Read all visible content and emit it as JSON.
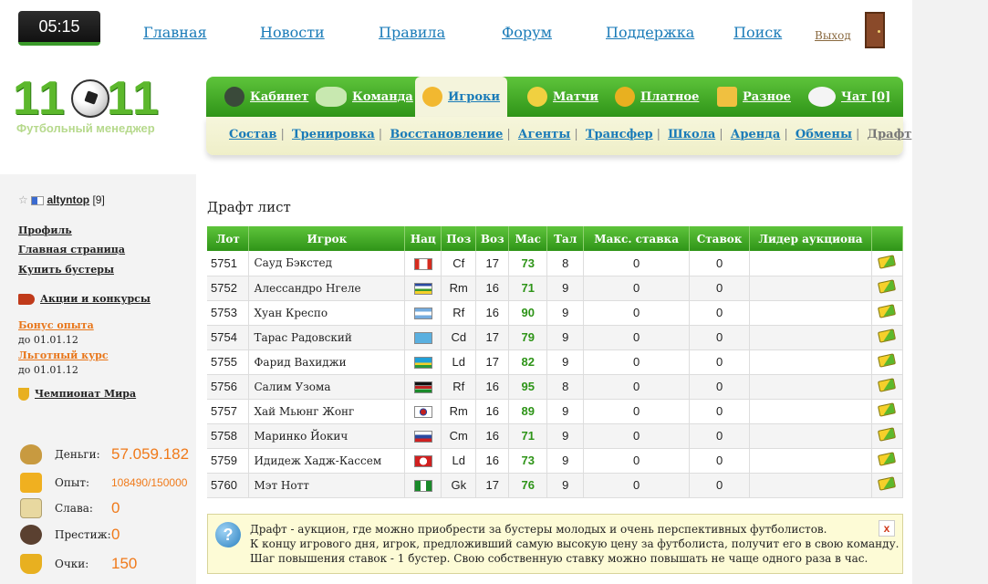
{
  "clock": "05:15",
  "top_nav": [
    "Главная",
    "Новости",
    "Правила",
    "Форум",
    "Поддержка",
    "Поиск"
  ],
  "logout": "Выход",
  "logo": {
    "number": "11",
    "number2": "11",
    "subtitle": "Футбольный менеджер"
  },
  "tabs": [
    {
      "label": "Кабинет",
      "icon": "manager-icon"
    },
    {
      "label": "Команда",
      "icon": "stadium-icon"
    },
    {
      "label": "Игроки",
      "icon": "players-icon"
    },
    {
      "label": "Матчи",
      "icon": "trophy-ball-icon"
    },
    {
      "label": "Платное",
      "icon": "coins-icon"
    },
    {
      "label": "Разное",
      "icon": "beer-icon"
    },
    {
      "label": "Чат [0]",
      "icon": "chat-bubble-icon"
    }
  ],
  "active_tab": "Игроки",
  "sub_tabs": [
    "Состав",
    "Тренировка",
    "Восстановление",
    "Агенты",
    "Трансфер",
    "Школа",
    "Аренда",
    "Обмены",
    "Драфт"
  ],
  "active_sub_tab": "Драфт",
  "sidebar": {
    "username": "altyntop",
    "level": "[9]",
    "links": [
      "Профиль",
      "Главная страница",
      "Купить бустеры"
    ],
    "promo": "Акции и конкурсы",
    "bonus1": {
      "label": "Бонус опыта",
      "until": "до 01.01.12"
    },
    "bonus2": {
      "label": "Льготный курс",
      "until": "до 01.01.12"
    },
    "championship": "Чемпионат Мира",
    "stats": [
      {
        "label": "Деньги:",
        "value": "57.059.182",
        "icon": "money-bag-icon"
      },
      {
        "label": "Опыт:",
        "value": "108490/150000",
        "icon": "experience-icon"
      },
      {
        "label": "Слава:",
        "value": "0",
        "icon": "podium-icon"
      },
      {
        "label": "Престиж:",
        "value": "0",
        "icon": "prestige-icon"
      },
      {
        "label": "Очки:",
        "value": "150",
        "icon": "cup-icon"
      }
    ]
  },
  "page_title": "Драфт лист",
  "table": {
    "headers": [
      "Лот",
      "Игрок",
      "Нац",
      "Поз",
      "Воз",
      "Мас",
      "Тал",
      "Макс. ставка",
      "Ставок",
      "Лидер аукциона",
      ""
    ],
    "rows": [
      {
        "lot": "5751",
        "name": "Сауд Бэкстед",
        "flag": "canada-flag",
        "pos": "Cf",
        "age": "17",
        "mas": "73",
        "tal": "8",
        "max_bid": "0",
        "bids": "0",
        "leader": ""
      },
      {
        "lot": "5752",
        "name": "Алессандро Нгеле",
        "flag": "central-african-republic-flag",
        "pos": "Rm",
        "age": "16",
        "mas": "71",
        "tal": "9",
        "max_bid": "0",
        "bids": "0",
        "leader": ""
      },
      {
        "lot": "5753",
        "name": "Хуан Креспо",
        "flag": "argentina-flag",
        "pos": "Rf",
        "age": "16",
        "mas": "90",
        "tal": "9",
        "max_bid": "0",
        "bids": "0",
        "leader": ""
      },
      {
        "lot": "5754",
        "name": "Тарас Радовский",
        "flag": "kazakhstan-flag",
        "pos": "Cd",
        "age": "17",
        "mas": "79",
        "tal": "9",
        "max_bid": "0",
        "bids": "0",
        "leader": ""
      },
      {
        "lot": "5755",
        "name": "Фарид Вахиджи",
        "flag": "rwanda-flag",
        "pos": "Ld",
        "age": "17",
        "mas": "82",
        "tal": "9",
        "max_bid": "0",
        "bids": "0",
        "leader": ""
      },
      {
        "lot": "5756",
        "name": "Салим Узома",
        "flag": "kenya-flag",
        "pos": "Rf",
        "age": "16",
        "mas": "95",
        "tal": "8",
        "max_bid": "0",
        "bids": "0",
        "leader": ""
      },
      {
        "lot": "5757",
        "name": "Хай Мьюнг Жонг",
        "flag": "south-korea-flag",
        "pos": "Rm",
        "age": "16",
        "mas": "89",
        "tal": "9",
        "max_bid": "0",
        "bids": "0",
        "leader": ""
      },
      {
        "lot": "5758",
        "name": "Маринко Йокич",
        "flag": "slovenia-flag",
        "pos": "Cm",
        "age": "16",
        "mas": "71",
        "tal": "9",
        "max_bid": "0",
        "bids": "0",
        "leader": ""
      },
      {
        "lot": "5759",
        "name": "Идидеж Хадж-Кассем",
        "flag": "tunisia-flag",
        "pos": "Ld",
        "age": "16",
        "mas": "73",
        "tal": "9",
        "max_bid": "0",
        "bids": "0",
        "leader": ""
      },
      {
        "lot": "5760",
        "name": "Мэт Нотт",
        "flag": "nigeria-flag",
        "pos": "Gk",
        "age": "17",
        "mas": "76",
        "tal": "9",
        "max_bid": "0",
        "bids": "0",
        "leader": ""
      }
    ]
  },
  "info": {
    "line1": "Драфт - аукцион, где можно приобрести за бустеры молодых и очень перспективных футболистов.",
    "line2": "К концу игрового дня, игрок, предложивший самую высокую цену за футболиста, получит его в свою команду.",
    "line3": "Шаг повышения ставок - 1 бустер. Свою собственную ставку можно повышать не чаще одного раза в час.",
    "close": "x"
  }
}
